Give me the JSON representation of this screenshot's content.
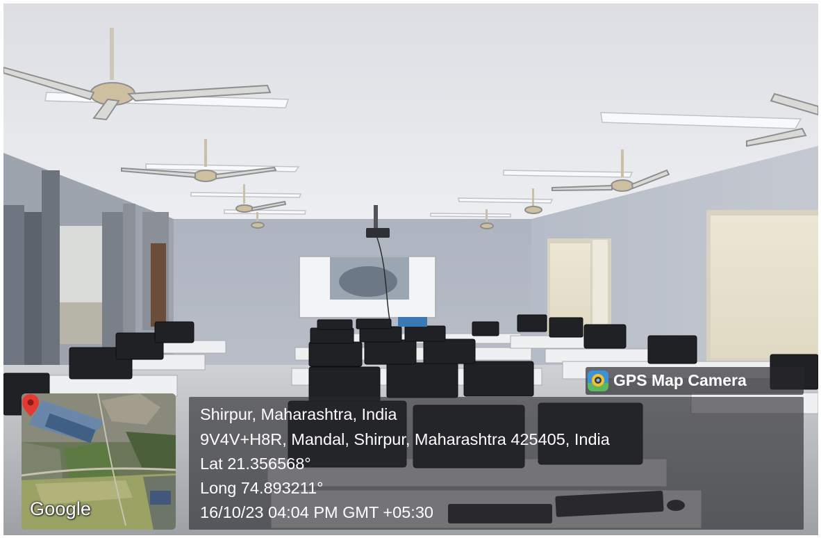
{
  "watermark": {
    "app_name": "GPS Map Camera",
    "icon": "gps-map-camera-app-icon"
  },
  "location": {
    "place": "Shirpur, Maharashtra, India",
    "address": "9V4V+H8R, Mandal, Shirpur, Maharashtra 425405, India",
    "latitude": "Lat 21.356568°",
    "longitude": "Long 74.893211°",
    "timestamp": "16/10/23 04:04 PM GMT +05:30"
  },
  "map": {
    "provider": "Google",
    "marker_icon": "map-pin-icon",
    "marker_color": "#e53935"
  },
  "colors": {
    "wall": "#b9bec9",
    "ceiling": "#e9ebef",
    "panel": "#28282c"
  }
}
